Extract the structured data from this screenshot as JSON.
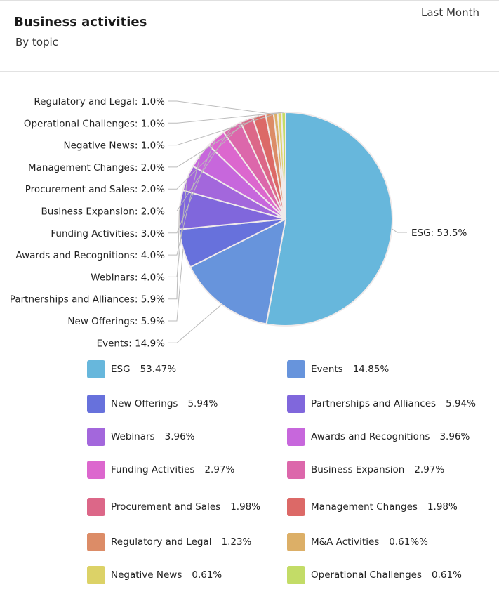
{
  "header": {
    "title": "Business activities",
    "subtitle": "By topic",
    "period": "Last Month"
  },
  "chart_data": {
    "type": "pie",
    "slices": [
      {
        "name": "ESG",
        "value": 53.47,
        "label": "ESG: 53.5%",
        "legend_value": "53.47%",
        "color": "#67b7dc"
      },
      {
        "name": "Events",
        "value": 14.85,
        "label": "Events: 14.9%",
        "legend_value": "14.85%",
        "color": "#6794dc"
      },
      {
        "name": "New Offerings",
        "value": 5.94,
        "label": "New Offerings: 5.9%",
        "legend_value": "5.94%",
        "color": "#6771dc"
      },
      {
        "name": "Partnerships and Alliances",
        "value": 5.94,
        "label": "Partnerships and Alliances: 5.9%",
        "legend_value": "5.94%",
        "color": "#8067dc"
      },
      {
        "name": "Webinars",
        "value": 3.96,
        "label": "Webinars: 4.0%",
        "legend_value": "3.96%",
        "color": "#a367dc"
      },
      {
        "name": "Awards and Recognitions",
        "value": 3.96,
        "label": "Awards and Recognitions: 4.0%",
        "legend_value": "3.96%",
        "color": "#c767dc"
      },
      {
        "name": "Funding Activities",
        "value": 2.97,
        "label": "Funding Activities: 3.0%",
        "legend_value": "2.97%",
        "color": "#dc67ce"
      },
      {
        "name": "Business Expansion",
        "value": 2.97,
        "label": "Business Expansion: 2.0%",
        "legend_value": "2.97%",
        "color": "#dc67ab"
      },
      {
        "name": "Procurement and Sales",
        "value": 1.98,
        "label": "Procurement and Sales: 2.0%",
        "legend_value": "1.98%",
        "color": "#dc6788"
      },
      {
        "name": "Management Changes",
        "value": 1.98,
        "label": "Management Changes: 2.0%",
        "legend_value": "1.98%",
        "color": "#dc6967"
      },
      {
        "name": "Regulatory and Legal",
        "value": 1.23,
        "label": "Regulatory and Legal: 1.0%",
        "legend_value": "1.23%",
        "color": "#dc8c67"
      },
      {
        "name": "M&A Activities",
        "value": 0.61,
        "label": "",
        "legend_value": "0.61%%",
        "color": "#dcaf67"
      },
      {
        "name": "Negative News",
        "value": 0.61,
        "label": "Negative News: 1.0%",
        "legend_value": "0.61%",
        "color": "#dcd267"
      },
      {
        "name": "Operational Challenges",
        "value": 0.61,
        "label": "Operational Challenges: 1.0%",
        "legend_value": "0.61%",
        "color": "#c3dc67"
      }
    ],
    "legend_position": "bottom"
  }
}
